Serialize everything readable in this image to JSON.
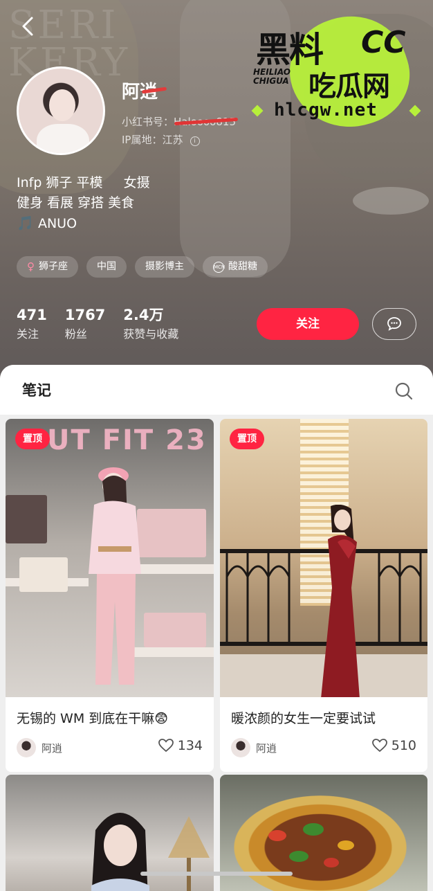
{
  "header": {
    "back_label": "‹",
    "nickname": "阿逍",
    "xhs_id_label": "小红书号：",
    "xhs_id_value": "Haloooo815",
    "ip_label": "IP属地：",
    "ip_value": "江苏",
    "info_icon": "ⓘ",
    "bio_line1": "Infp 狮子 平模     女摄",
    "bio_line2": "健身 看展 穿搭 美食",
    "bio_line3": "ANUO",
    "music_icon": "🎵",
    "tags": [
      {
        "icon": "♀",
        "label": "狮子座"
      },
      {
        "icon": "",
        "label": "中国"
      },
      {
        "icon": "",
        "label": "摄影博主"
      },
      {
        "icon": "MCN",
        "label": "酸甜糖"
      }
    ],
    "stats": [
      {
        "num": "471",
        "label": "关注"
      },
      {
        "num": "1767",
        "label": "粉丝"
      },
      {
        "num": "2.4万",
        "label": "获赞与收藏"
      }
    ],
    "follow_label": "关注"
  },
  "watermark": {
    "big1": "黑料",
    "cc": "CC",
    "small1": "HEILIAO",
    "small2": "CHIGUA",
    "big2": "吃瓜网",
    "url": "hlcgw.net"
  },
  "tabs": {
    "notes_label": "笔记"
  },
  "cards": [
    {
      "pin": "置顶",
      "neon": "UT FIT 23",
      "title": "无锡的 WM 到底在干嘛😨",
      "author": "阿逍",
      "likes": "134"
    },
    {
      "pin": "置顶",
      "title": "暖浓颜的女生一定要试试",
      "author": "阿逍",
      "likes": "510"
    }
  ],
  "colors": {
    "brand_red": "#ff2442",
    "watermark_green": "#b7f03a"
  }
}
